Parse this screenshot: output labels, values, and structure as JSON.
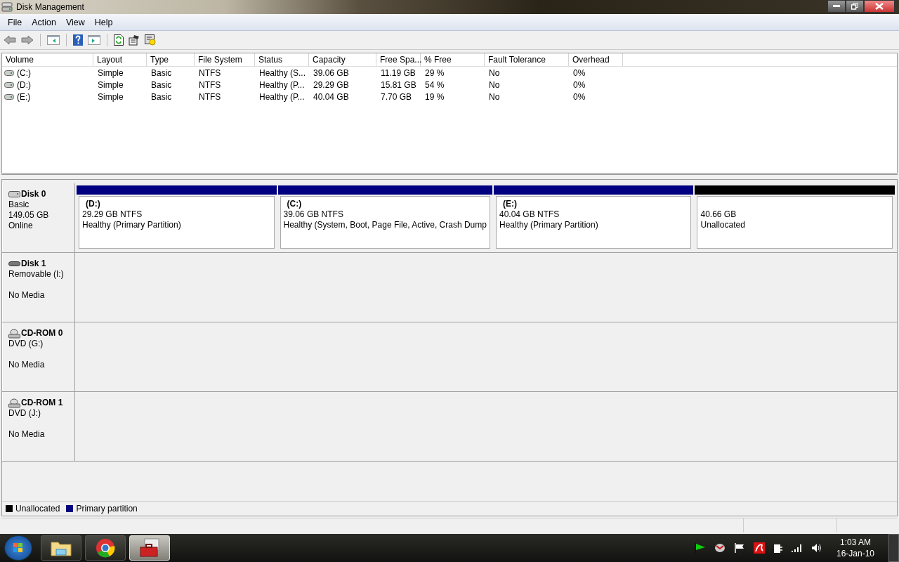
{
  "window": {
    "title": "Disk Management"
  },
  "menu": [
    "File",
    "Action",
    "View",
    "Help"
  ],
  "table": {
    "columns": [
      "Volume",
      "Layout",
      "Type",
      "File System",
      "Status",
      "Capacity",
      "Free Spa...",
      "% Free",
      "Fault Tolerance",
      "Overhead"
    ],
    "rows": [
      [
        "(C:)",
        "Simple",
        "Basic",
        "NTFS",
        "Healthy (S...",
        "39.06 GB",
        "11.19 GB",
        "29 %",
        "No",
        "0%"
      ],
      [
        "(D:)",
        "Simple",
        "Basic",
        "NTFS",
        "Healthy (P...",
        "29.29 GB",
        "15.81 GB",
        "54 %",
        "No",
        "0%"
      ],
      [
        "(E:)",
        "Simple",
        "Basic",
        "NTFS",
        "Healthy (P...",
        "40.04 GB",
        "7.70 GB",
        "19 %",
        "No",
        "0%"
      ]
    ]
  },
  "disks": [
    {
      "kind": "hdd",
      "name": "Disk 0",
      "type": "Basic",
      "size": "149.05 GB",
      "status": "Online",
      "partitions": [
        {
          "kind": "primary",
          "label": "(D:)",
          "size": "29.29 GB NTFS",
          "status": "Healthy (Primary Partition)"
        },
        {
          "kind": "primary",
          "label": "(C:)",
          "size": "39.06 GB NTFS",
          "status": "Healthy (System, Boot, Page File, Active, Crash Dump"
        },
        {
          "kind": "primary",
          "label": "(E:)",
          "size": "40.04 GB NTFS",
          "status": "Healthy (Primary Partition)"
        },
        {
          "kind": "unallocated",
          "size": "40.66 GB",
          "status": "Unallocated"
        }
      ]
    },
    {
      "kind": "removable",
      "name": "Disk 1",
      "type": "Removable (I:)",
      "status": "No Media"
    },
    {
      "kind": "cdrom",
      "name": "CD-ROM 0",
      "type": "DVD (G:)",
      "status": "No Media"
    },
    {
      "kind": "cdrom",
      "name": "CD-ROM 1",
      "type": "DVD (J:)",
      "status": "No Media"
    }
  ],
  "legend": [
    {
      "label": "Unallocated",
      "color": "#000000"
    },
    {
      "label": "Primary partition",
      "color": "#000080"
    }
  ],
  "taskbar": {
    "apps": [
      {
        "kind": "folder",
        "selected": false
      },
      {
        "kind": "browser",
        "selected": false
      },
      {
        "kind": "toolbox",
        "selected": true
      }
    ],
    "time": "1:03 AM",
    "date": "16-Jan-10"
  }
}
